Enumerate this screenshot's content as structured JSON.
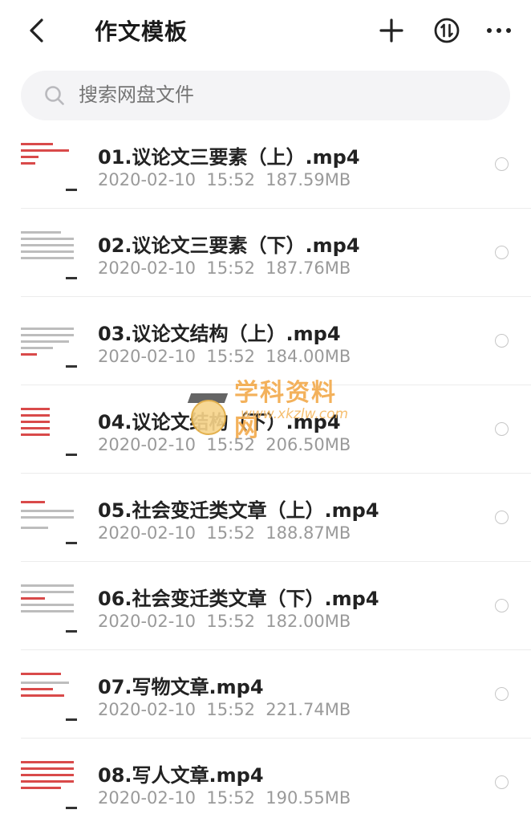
{
  "header": {
    "title": "作文模板"
  },
  "search": {
    "placeholder": "搜索网盘文件"
  },
  "files": [
    {
      "name": "01.议论文三要素（上）.mp4",
      "date": "2020-02-10",
      "time": "15:52",
      "size": "187.59MB"
    },
    {
      "name": "02.议论文三要素（下）.mp4",
      "date": "2020-02-10",
      "time": "15:52",
      "size": "187.76MB"
    },
    {
      "name": "03.议论文结构（上）.mp4",
      "date": "2020-02-10",
      "time": "15:52",
      "size": "184.00MB"
    },
    {
      "name": "04.议论文结构（下）.mp4",
      "date": "2020-02-10",
      "time": "15:52",
      "size": "206.50MB"
    },
    {
      "name": "05.社会变迁类文章（上）.mp4",
      "date": "2020-02-10",
      "time": "15:52",
      "size": "188.87MB"
    },
    {
      "name": "06.社会变迁类文章（下）.mp4",
      "date": "2020-02-10",
      "time": "15:52",
      "size": "182.00MB"
    },
    {
      "name": "07.写物文章.mp4",
      "date": "2020-02-10",
      "time": "15:52",
      "size": "221.74MB"
    },
    {
      "name": "08.写人文章.mp4",
      "date": "2020-02-10",
      "time": "15:52",
      "size": "190.55MB"
    }
  ],
  "watermark": {
    "text": "学科资料网",
    "url": "www.xkzlw.com"
  },
  "icons": {
    "back": "chevron-left-icon",
    "add": "plus-icon",
    "sort": "sort-arrows-icon",
    "more": "more-dots-icon",
    "search": "search-icon"
  }
}
